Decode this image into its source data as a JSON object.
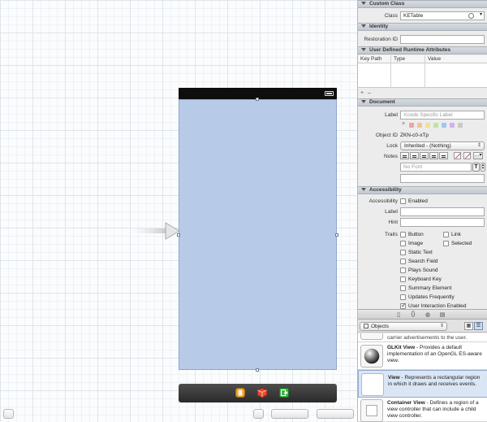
{
  "canvas": {
    "dock_icons": [
      "view-controller-icon",
      "first-responder-icon",
      "exit-icon"
    ]
  },
  "inspector": {
    "custom_class": {
      "header": "Custom Class",
      "class_label": "Class",
      "class_value": "KETable"
    },
    "identity": {
      "header": "Identity",
      "restoration_label": "Restoration ID",
      "restoration_value": ""
    },
    "runtime_attributes": {
      "header": "User Defined Runtime Attributes",
      "columns": [
        "Key Path",
        "Type",
        "Value"
      ],
      "add_label": "+",
      "remove_label": "–"
    },
    "document": {
      "header": "Document",
      "label_label": "Label",
      "label_placeholder": "Xcode Specific Label",
      "clear_label": "×",
      "swatch_colors": [
        "#f2a3a3",
        "#f4c493",
        "#eee38c",
        "#bfe49a",
        "#9fc7ef",
        "#d2b0ea",
        "#c9c9c9"
      ],
      "object_id_label": "Object ID",
      "object_id_value": "ZKN-c0-xTp",
      "lock_label": "Lock",
      "lock_value": "Inherited - (Nothing)",
      "notes_label": "Notes",
      "font_placeholder": "No Font",
      "font_button": "T"
    },
    "accessibility": {
      "header": "Accessibility",
      "accessibility_label": "Accessibility",
      "enabled_label": "Enabled",
      "enabled": false,
      "label_label": "Label",
      "hint_label": "Hint",
      "traits_label": "Traits",
      "traits": [
        {
          "label": "Button",
          "checked": false
        },
        {
          "label": "Link",
          "checked": false
        },
        {
          "label": "Image",
          "checked": false
        },
        {
          "label": "Selected",
          "checked": false
        },
        {
          "label": "Static Text",
          "checked": false
        },
        {
          "label": "Search Field",
          "checked": false
        },
        {
          "label": "Plays Sound",
          "checked": false
        },
        {
          "label": "Keyboard Key",
          "checked": false
        },
        {
          "label": "Summary Element",
          "checked": false
        },
        {
          "label": "Updates Frequently",
          "checked": false
        },
        {
          "label": "User Interaction Enabled",
          "checked": true
        }
      ]
    }
  },
  "library": {
    "filter_value": "Objects",
    "partial_text": "carrier advertisements to the user.",
    "items": [
      {
        "title": "GLKit View",
        "desc": " - Provides a default implementation of an OpenGL ES-aware view."
      },
      {
        "title": "View",
        "desc": " - Represents a rectangular region in which it draws and receives events."
      },
      {
        "title": "Container View",
        "desc": " - Defines a region of a view controller that can include a child view controller."
      }
    ]
  }
}
